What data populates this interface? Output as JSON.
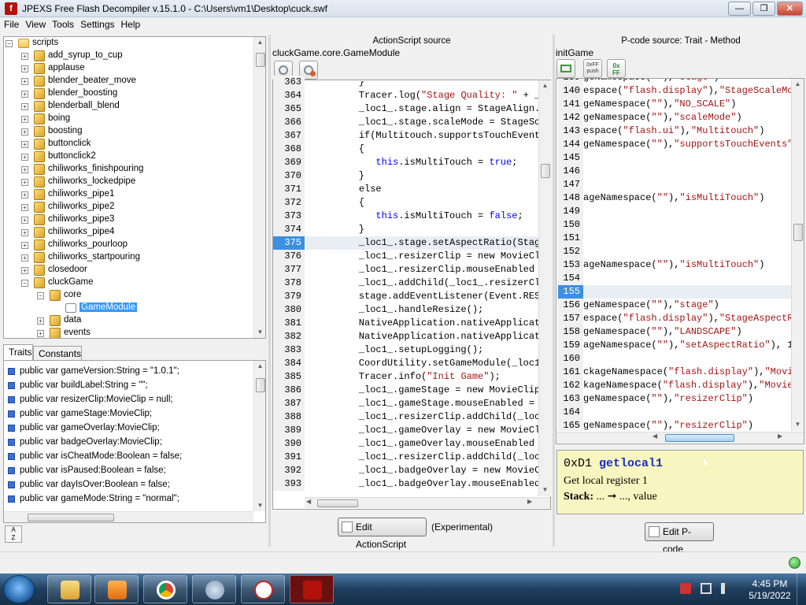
{
  "window": {
    "title": "JPEXS Free Flash Decompiler v.15.1.0 - C:\\Users\\vm1\\Desktop\\cuck.swf"
  },
  "menu": [
    "File",
    "View",
    "Tools",
    "Settings",
    "Help"
  ],
  "tree": {
    "root": "scripts",
    "items": [
      "add_syrup_to_cup",
      "applause",
      "blender_beater_move",
      "blender_boosting",
      "blenderball_blend",
      "boing",
      "boosting",
      "buttonclick",
      "buttonclick2",
      "chiliworks_finishpouring",
      "chiliworks_lockedpipe",
      "chiliworks_pipe1",
      "chiliworks_pipe2",
      "chiliworks_pipe3",
      "chiliworks_pipe4",
      "chiliworks_pourloop",
      "chiliworks_startpouring",
      "closedoor",
      "cluckGame"
    ],
    "core": "core",
    "selected": "GameModule",
    "after": [
      "data",
      "events"
    ]
  },
  "bottom_tabs": [
    "Traits",
    "Constants"
  ],
  "traits": [
    "public var gameVersion:String = \"1.0.1\";",
    "public var buildLabel:String = \"\";",
    "public var resizerClip:MovieClip = null;",
    "public var gameStage:MovieClip;",
    "public var gameOverlay:MovieClip;",
    "public var badgeOverlay:MovieClip;",
    "public var isCheatMode:Boolean = false;",
    "public var isPaused:Boolean = false;",
    "public var dayIsOver:Boolean = false;",
    "public var gameMode:String = \"normal\";"
  ],
  "sort_label": "A\nZ",
  "as_panel": {
    "header": "ActionScript source",
    "path": "cluckGame.core.GameModule",
    "line_numbers": [
      "363",
      "364",
      "365",
      "366",
      "367",
      "368",
      "369",
      "370",
      "371",
      "372",
      "373",
      "374",
      "375",
      "376",
      "377",
      "378",
      "379",
      "380",
      "381",
      "382",
      "383",
      "384",
      "385",
      "386",
      "387",
      "388",
      "389",
      "390",
      "391",
      "392",
      "393"
    ],
    "highlight_index": 12,
    "lines": [
      "         }",
      "         Tracer.log(\"Stage Quality: \" + _l",
      "         _loc1_.stage.align = StageAlign.T",
      "         _loc1_.stage.scaleMode = StageSca",
      "         if(Multitouch.supportsTouchEvents",
      "         {",
      "            this.isMultiTouch = true;",
      "         }",
      "         else",
      "         {",
      "            this.isMultiTouch = false;",
      "         }",
      "         _loc1_.stage.setAspectRatio(Stage",
      "         _loc1_.resizerClip = new MovieCli",
      "         _loc1_.resizerClip.mouseEnabled = f",
      "         _loc1_.addChild(_loc1_.resizerCli",
      "         stage.addEventListener(Event.RESI",
      "         _loc1_.handleResize();",
      "         NativeApplication.nativeApplicati",
      "         NativeApplication.nativeApplicati",
      "         _loc1_.setupLogging();",
      "         CoordUtility.setGameModule(_loc1_",
      "         Tracer.info(\"Init Game\");",
      "         _loc1_.gameStage = new MovieClip(",
      "         _loc1_.gameStage.mouseEnabled = f",
      "         _loc1_.resizerClip.addChild(_loc1",
      "         _loc1_.gameOverlay = new MovieCli",
      "         _loc1_.gameOverlay.mouseEnabled =",
      "         _loc1_.resizerClip.addChild(_loc1",
      "         _loc1_.badgeOverlay = new MovieCl",
      "         _loc1_.badgeOverlay.mouseEnabled"
    ],
    "edit_button": "Edit ActionScript",
    "experimental": "(Experimental)"
  },
  "pcode_panel": {
    "header": "P-code source: Trait - Method",
    "trait_name": "initGame",
    "tool_labels": [
      "0xFF\npush",
      "0x\nFF"
    ],
    "line_numbers": [
      "139",
      "140",
      "141",
      "142",
      "143",
      "144",
      "145",
      "146",
      "147",
      "148",
      "149",
      "150",
      "151",
      "152",
      "153",
      "154",
      "155",
      "156",
      "157",
      "158",
      "159",
      "160",
      "161",
      "162",
      "163",
      "164",
      "165"
    ],
    "highlight_index": 16,
    "lines": [
      "geNamespace(\"\"),\"stage\")",
      "espace(\"flash.display\"),\"StageScaleMod",
      "geNamespace(\"\"),\"NO_SCALE\")",
      "geNamespace(\"\"),\"scaleMode\")",
      "espace(\"flash.ui\"),\"Multitouch\")",
      "geNamespace(\"\"),\"supportsTouchEvents\")",
      "",
      "",
      "",
      "ageNamespace(\"\"),\"isMultiTouch\")",
      "",
      "",
      "",
      "",
      "ageNamespace(\"\"),\"isMultiTouch\")",
      "",
      "",
      "geNamespace(\"\"),\"stage\")",
      "espace(\"flash.display\"),\"StageAspectRa",
      "geNamespace(\"\"),\"LANDSCAPE\")",
      "ageNamespace(\"\"),\"setAspectRatio\"), 1",
      "",
      "ckageNamespace(\"flash.display\"),\"Movie",
      "kageNamespace(\"flash.display\"),\"MovieC",
      "geNamespace(\"\"),\"resizerClip\")",
      "",
      "geNamespace(\"\"),\"resizerClip\")"
    ],
    "edit_button": "Edit P-code"
  },
  "info_box": {
    "opcode": "0xD1",
    "name": "getlocal1",
    "description": "Get local register 1",
    "stack_label": "Stack:",
    "stack": "... ➞ ..., value"
  },
  "taskbar": {
    "time": "4:45 PM",
    "date": "5/19/2022"
  }
}
